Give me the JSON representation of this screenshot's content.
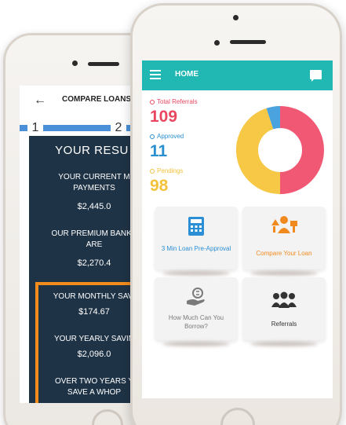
{
  "back_screen": {
    "title": "COMPARE LOANS",
    "steps": [
      "1",
      "2"
    ],
    "results_title": "YOUR RESU",
    "current_label": "YOUR CURRENT M\nPAYMENTS",
    "current_value": "$2,445.0",
    "premium_label": "OUR PREMIUM BANKS\nARE",
    "premium_value": "$2,270.4",
    "monthly_label": "YOUR MONTHLY SAVI",
    "monthly_value": "$174.67",
    "yearly_label": "YOUR YEARLY SAVIN",
    "yearly_value": "$2,096.0",
    "twoyears_label": "OVER TWO YEARS Y\nSAVE A WHOP"
  },
  "front_screen": {
    "app_title": "HOME",
    "stats": [
      {
        "label": "Total Referrals",
        "value": "109",
        "color": "#e8475f"
      },
      {
        "label": "Approved",
        "value": "11",
        "color": "#2a8fcf"
      },
      {
        "label": "Pendings",
        "value": "98",
        "color": "#f3c23b"
      }
    ],
    "chart_data": {
      "type": "pie",
      "categories": [
        "Total Referrals",
        "Approved",
        "Pendings"
      ],
      "values": [
        109,
        11,
        98
      ],
      "colors": [
        "#f05873",
        "#4aa3df",
        "#f6c846"
      ]
    },
    "tiles": [
      {
        "label": "3 Min Loan Pre-Approval",
        "color": "#2b8fd6",
        "icon": "calculator-icon"
      },
      {
        "label": "Compare Your Loan",
        "color": "#f08a1f",
        "icon": "compare-people-icon"
      },
      {
        "label": "How Much Can You Borrow?",
        "color": "#7a7a7a",
        "icon": "money-hand-icon"
      },
      {
        "label": "Referrals",
        "color": "#333333",
        "icon": "group-people-icon"
      }
    ]
  }
}
